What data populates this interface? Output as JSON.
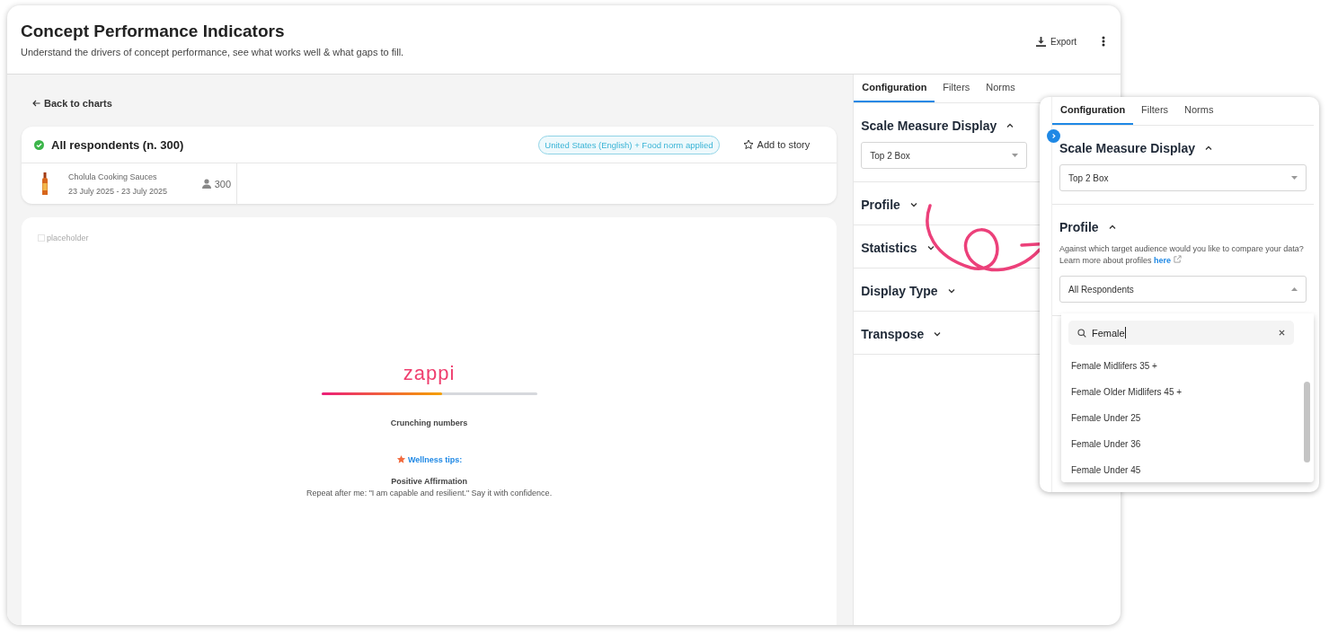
{
  "header": {
    "title": "Concept Performance Indicators",
    "subtitle": "Understand the drivers of concept performance, see what works well & what gaps to fill.",
    "export": "Export"
  },
  "back_link": "Back to charts",
  "audience_card": {
    "title": "All respondents (n. 300)",
    "complete": true,
    "norm_badge": "United States (English) + Food norm applied",
    "add_to_story": "Add to story",
    "product": {
      "name": "Cholula Cooking Sauces",
      "dates": "23 July 2025 - 23 July 2025",
      "respondents": "300"
    }
  },
  "loading_card": {
    "image_alt": "placeholder",
    "logo": "zappi",
    "progress": {
      "level": 0.56
    },
    "status": "Crunching numbers",
    "tips_label": "Wellness tips:",
    "tip_title": "Positive Affirmation",
    "tip_text": "Repeat after me: \"I am capable and resilient.\" Say it with confidence."
  },
  "side_panel": {
    "tabs": [
      {
        "label": "Configuration",
        "selected": true
      },
      {
        "label": "Filters",
        "selected": false
      },
      {
        "label": "Norms",
        "selected": false
      }
    ],
    "sections": [
      {
        "title": "Scale Measure Display",
        "expanded": true,
        "value": "Top 2 Box"
      },
      {
        "title": "Profile",
        "expanded": false
      },
      {
        "title": "Statistics",
        "expanded": false
      },
      {
        "title": "Display Type",
        "expanded": false
      },
      {
        "title": "Transpose",
        "expanded": false
      }
    ]
  },
  "zoom_panel": {
    "tabs": [
      {
        "label": "Configuration",
        "selected": true
      },
      {
        "label": "Filters",
        "selected": false
      },
      {
        "label": "Norms",
        "selected": false
      }
    ],
    "sections": [
      {
        "title": "Scale Measure Display",
        "expanded": true,
        "value": "Top 2 Box"
      },
      {
        "title": "Profile",
        "expanded": true,
        "description": "Against which target audience would you like to compare your data? Learn more about profiles",
        "link": "here",
        "value": "All Respondents"
      }
    ],
    "dropdown": {
      "open": true,
      "search": "Female",
      "options": [
        {
          "label": "Female Midlifers 35 +"
        },
        {
          "label": "Female Older Midlifers 45 +"
        },
        {
          "label": "Female Under 25"
        },
        {
          "label": "Female Under 36"
        },
        {
          "label": "Female Under 45"
        }
      ]
    }
  }
}
